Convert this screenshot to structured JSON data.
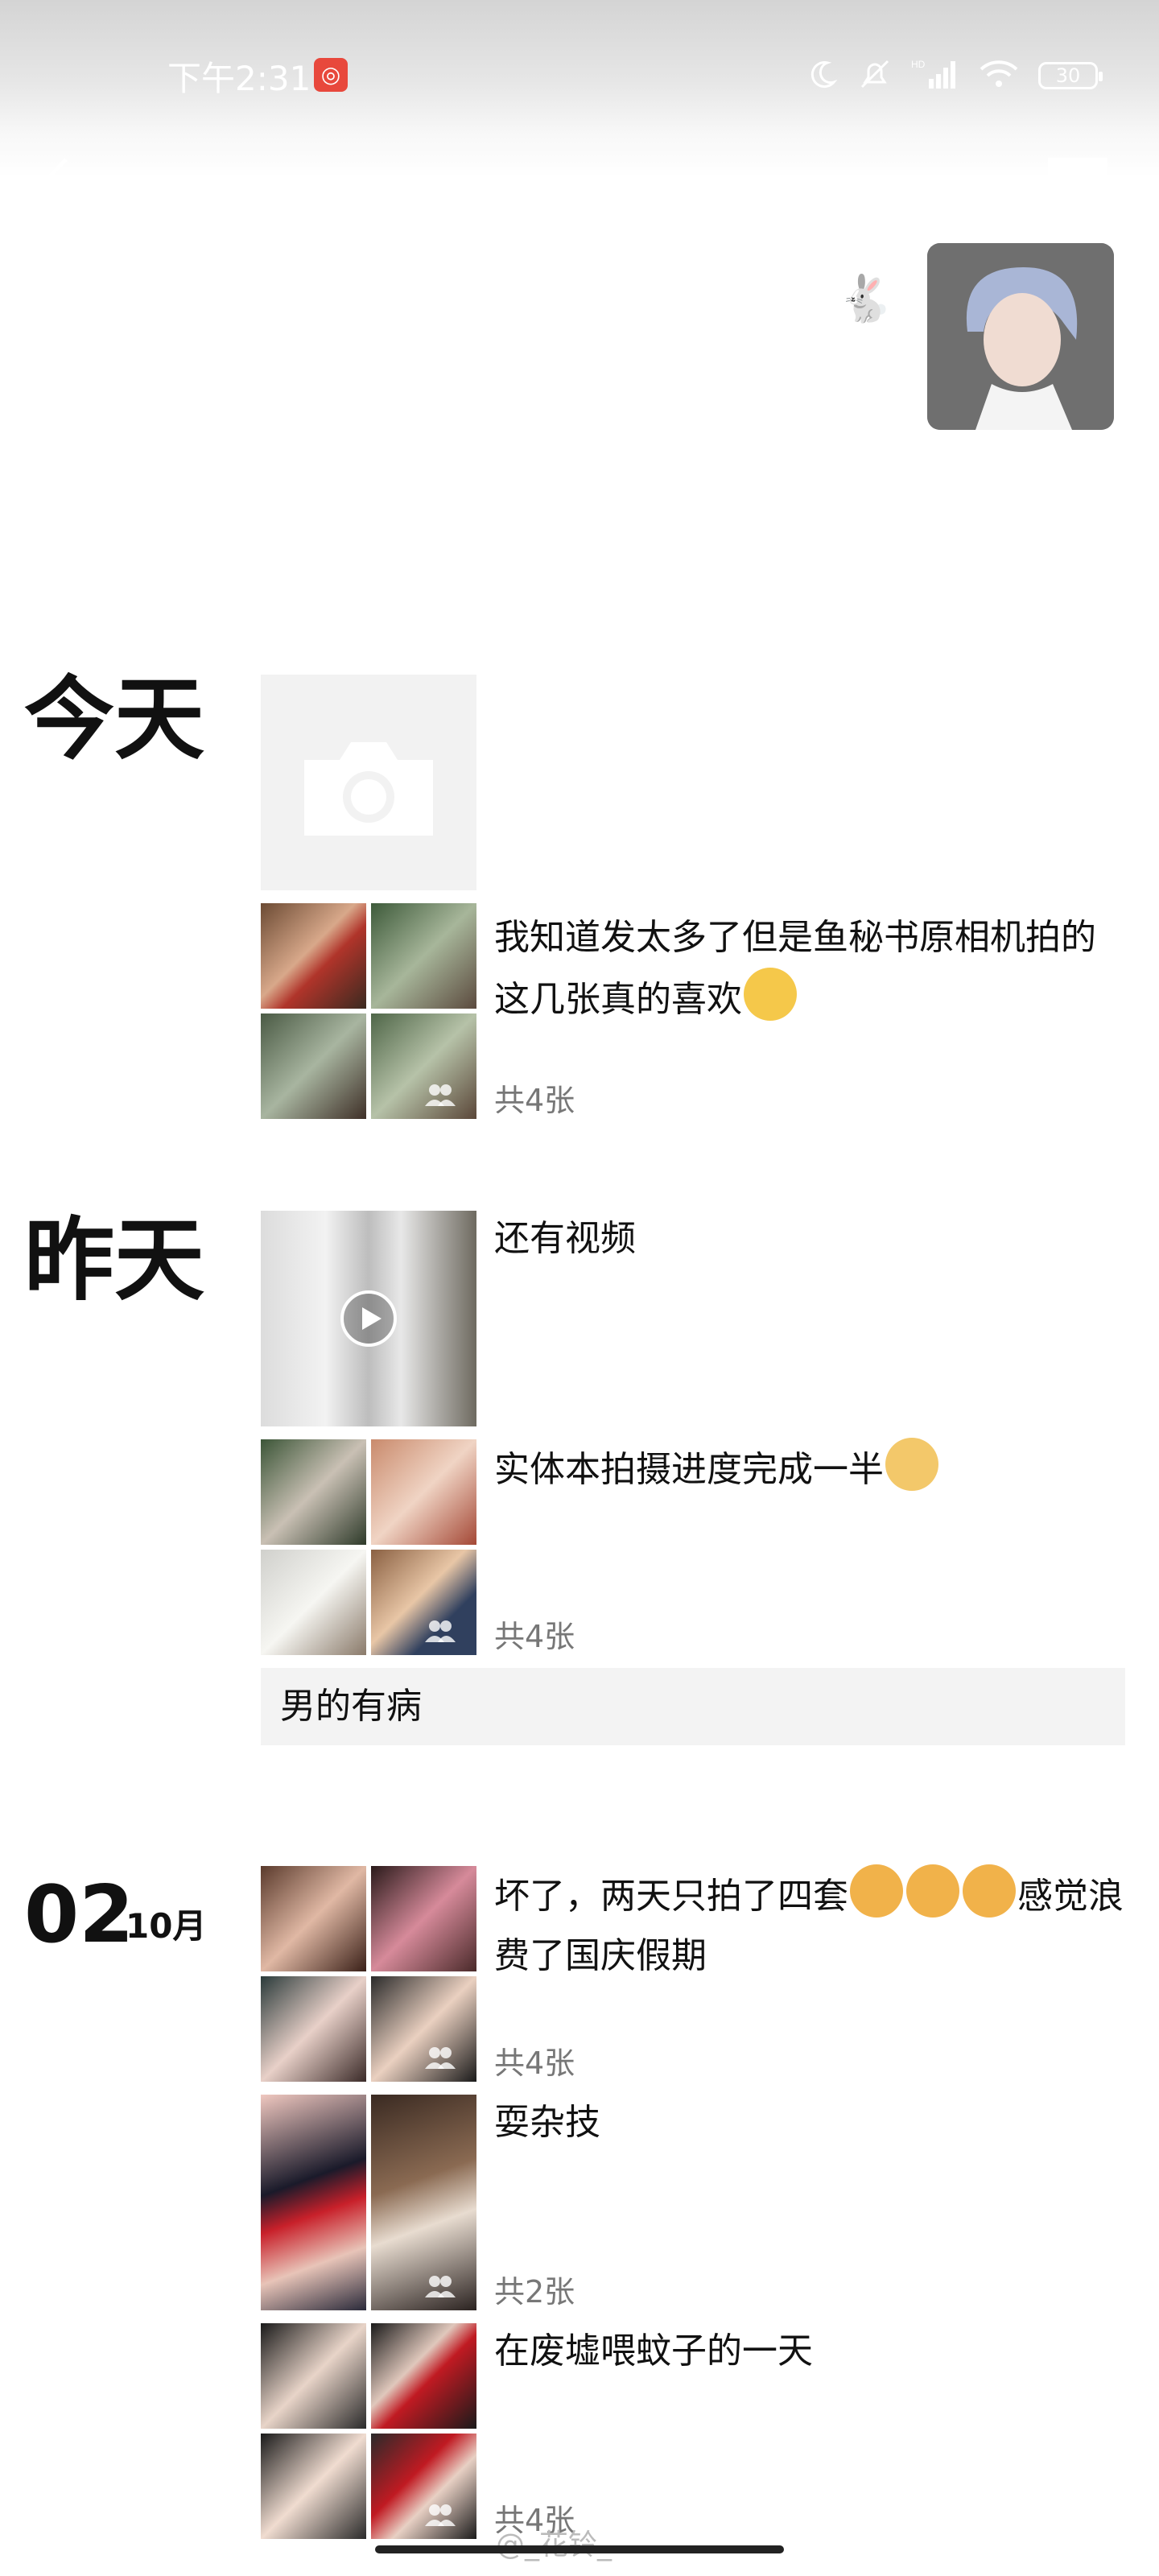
{
  "status_bar": {
    "time": "下午2:31",
    "battery": "30"
  },
  "icons": {
    "back": "chevron-left-icon",
    "comment": "comment-icon",
    "camera": "camera-icon",
    "play": "play-icon",
    "multi": "multi-image-icon"
  },
  "sections": {
    "today": "今天",
    "yesterday": "昨天",
    "day_num": "02",
    "day_month": "10月"
  },
  "posts": {
    "p1": {
      "text": "我知道发太多了但是鱼秘书原相机拍的这几张真的喜欢",
      "count": "共4张"
    },
    "p2": {
      "text": "还有视频"
    },
    "p3": {
      "text": "实体本拍摄进度完成一半",
      "count": "共4张"
    },
    "p4": {
      "text": "男的有病"
    },
    "p5": {
      "text_a": "坏了，两天只拍了四套",
      "text_b": "感觉浪费了国庆假期",
      "count": "共4张"
    },
    "p6": {
      "text": "耍杂技",
      "count": "共2张"
    },
    "p7": {
      "text": "在废墟喂蚊子的一天",
      "count": "共4张"
    }
  },
  "watermark": "@_花铃_",
  "colors": {
    "accent_red": "#e8483c",
    "text_gray": "#777777",
    "placeholder": "#f2f2f2"
  }
}
